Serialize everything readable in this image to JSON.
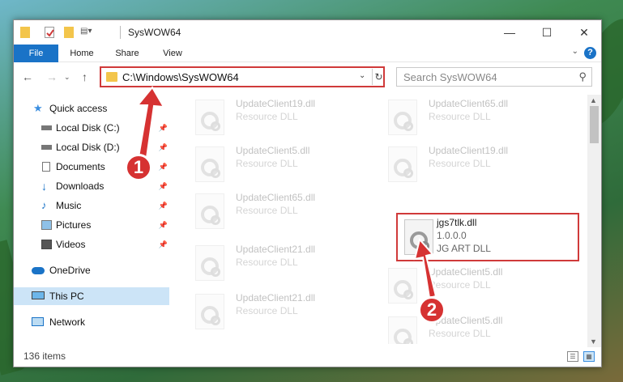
{
  "window": {
    "title": "SysWOW64",
    "controls": {
      "minimize": "—",
      "maximize": "☐",
      "close": "✕"
    }
  },
  "ribbon": {
    "tabs": [
      "File",
      "Home",
      "Share",
      "View"
    ],
    "help": "?"
  },
  "nav": {
    "address": "C:\\Windows\\SysWOW64",
    "search_placeholder": "Search SysWOW64"
  },
  "sidebar": {
    "items": [
      {
        "label": "Quick access",
        "icon": "star-icon"
      },
      {
        "label": "Local Disk (C:)",
        "icon": "drive-icon"
      },
      {
        "label": "Local Disk (D:)",
        "icon": "drive-icon"
      },
      {
        "label": "Documents",
        "icon": "documents-icon"
      },
      {
        "label": "Downloads",
        "icon": "download-icon"
      },
      {
        "label": "Music",
        "icon": "music-icon"
      },
      {
        "label": "Pictures",
        "icon": "pictures-icon"
      },
      {
        "label": "Videos",
        "icon": "videos-icon"
      },
      {
        "label": "OneDrive",
        "icon": "cloud-icon"
      },
      {
        "label": "This PC",
        "icon": "computer-icon"
      },
      {
        "label": "Network",
        "icon": "network-icon"
      }
    ]
  },
  "files": [
    {
      "name": "UpdateClient19.dll",
      "type": "Resource DLL"
    },
    {
      "name": "UpdateClient65.dll",
      "type": "Resource DLL"
    },
    {
      "name": "UpdateClient5.dll",
      "type": "Resource DLL"
    },
    {
      "name": "UpdateClient19.dll",
      "type": "Resource DLL"
    },
    {
      "name": "UpdateClient65.dll",
      "type": "Resource DLL"
    },
    {
      "name": "jgs7tlk.dll",
      "version": "1.0.0.0",
      "type": "JG ART DLL"
    },
    {
      "name": "UpdateClient21.dll",
      "type": "Resource DLL"
    },
    {
      "name": "UpdateClient5.dll",
      "type": "Resource DLL"
    },
    {
      "name": "UpdateClient21.dll",
      "type": "Resource DLL"
    },
    {
      "name": "UpdateClient5.dll",
      "type": "Resource DLL"
    }
  ],
  "status": {
    "item_count": "136 items"
  },
  "annotations": {
    "step1": "1",
    "step2": "2"
  },
  "colors": {
    "accent": "#1a73c7",
    "highlight": "#d03a3a"
  }
}
